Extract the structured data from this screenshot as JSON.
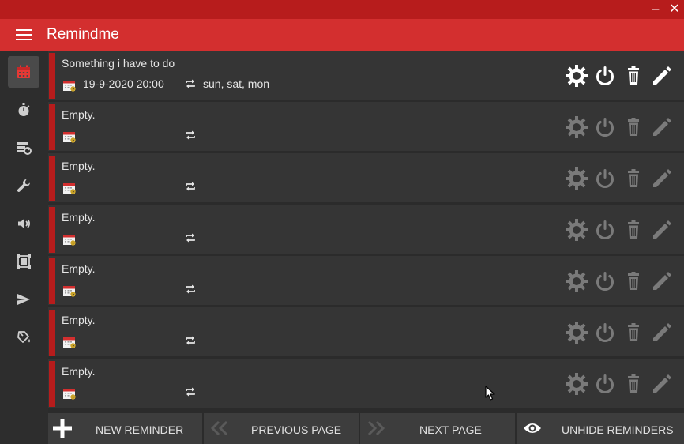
{
  "app": {
    "title": "Remindme"
  },
  "window": {
    "minimize_glyph": "‒",
    "close_glyph": "✕"
  },
  "sidebar": {
    "items": [
      {
        "name": "calendar-icon",
        "active": true
      },
      {
        "name": "stopwatch-icon",
        "active": false
      },
      {
        "name": "backup-icon",
        "active": false
      },
      {
        "name": "wrench-icon",
        "active": false
      },
      {
        "name": "volume-icon",
        "active": false
      },
      {
        "name": "resize-icon",
        "active": false
      },
      {
        "name": "send-icon",
        "active": false
      },
      {
        "name": "paint-bucket-icon",
        "active": false
      }
    ]
  },
  "reminders": [
    {
      "title": "Something i have to do",
      "date": "19-9-2020 20:00",
      "days": "sun, sat, mon",
      "active": true
    },
    {
      "title": "Empty.",
      "date": "",
      "days": "",
      "active": false
    },
    {
      "title": "Empty.",
      "date": "",
      "days": "",
      "active": false
    },
    {
      "title": "Empty.",
      "date": "",
      "days": "",
      "active": false
    },
    {
      "title": "Empty.",
      "date": "",
      "days": "",
      "active": false
    },
    {
      "title": "Empty.",
      "date": "",
      "days": "",
      "active": false
    },
    {
      "title": "Empty.",
      "date": "",
      "days": "",
      "active": false
    }
  ],
  "row_actions": [
    "settings-gear-icon",
    "power-icon",
    "trash-icon",
    "pencil-icon"
  ],
  "footer": {
    "new_reminder": "NEW REMINDER",
    "previous_page": "PREVIOUS PAGE",
    "next_page": "NEXT PAGE",
    "unhide_reminders": "UNHIDE REMINDERS"
  },
  "colors": {
    "title_bar": "#b71c1c",
    "app_bar": "#d32f2f",
    "accent": "#b71c1c",
    "row_background": "#353535",
    "icon_active": "#ffffff",
    "icon_inactive": "#7a7a7a"
  }
}
